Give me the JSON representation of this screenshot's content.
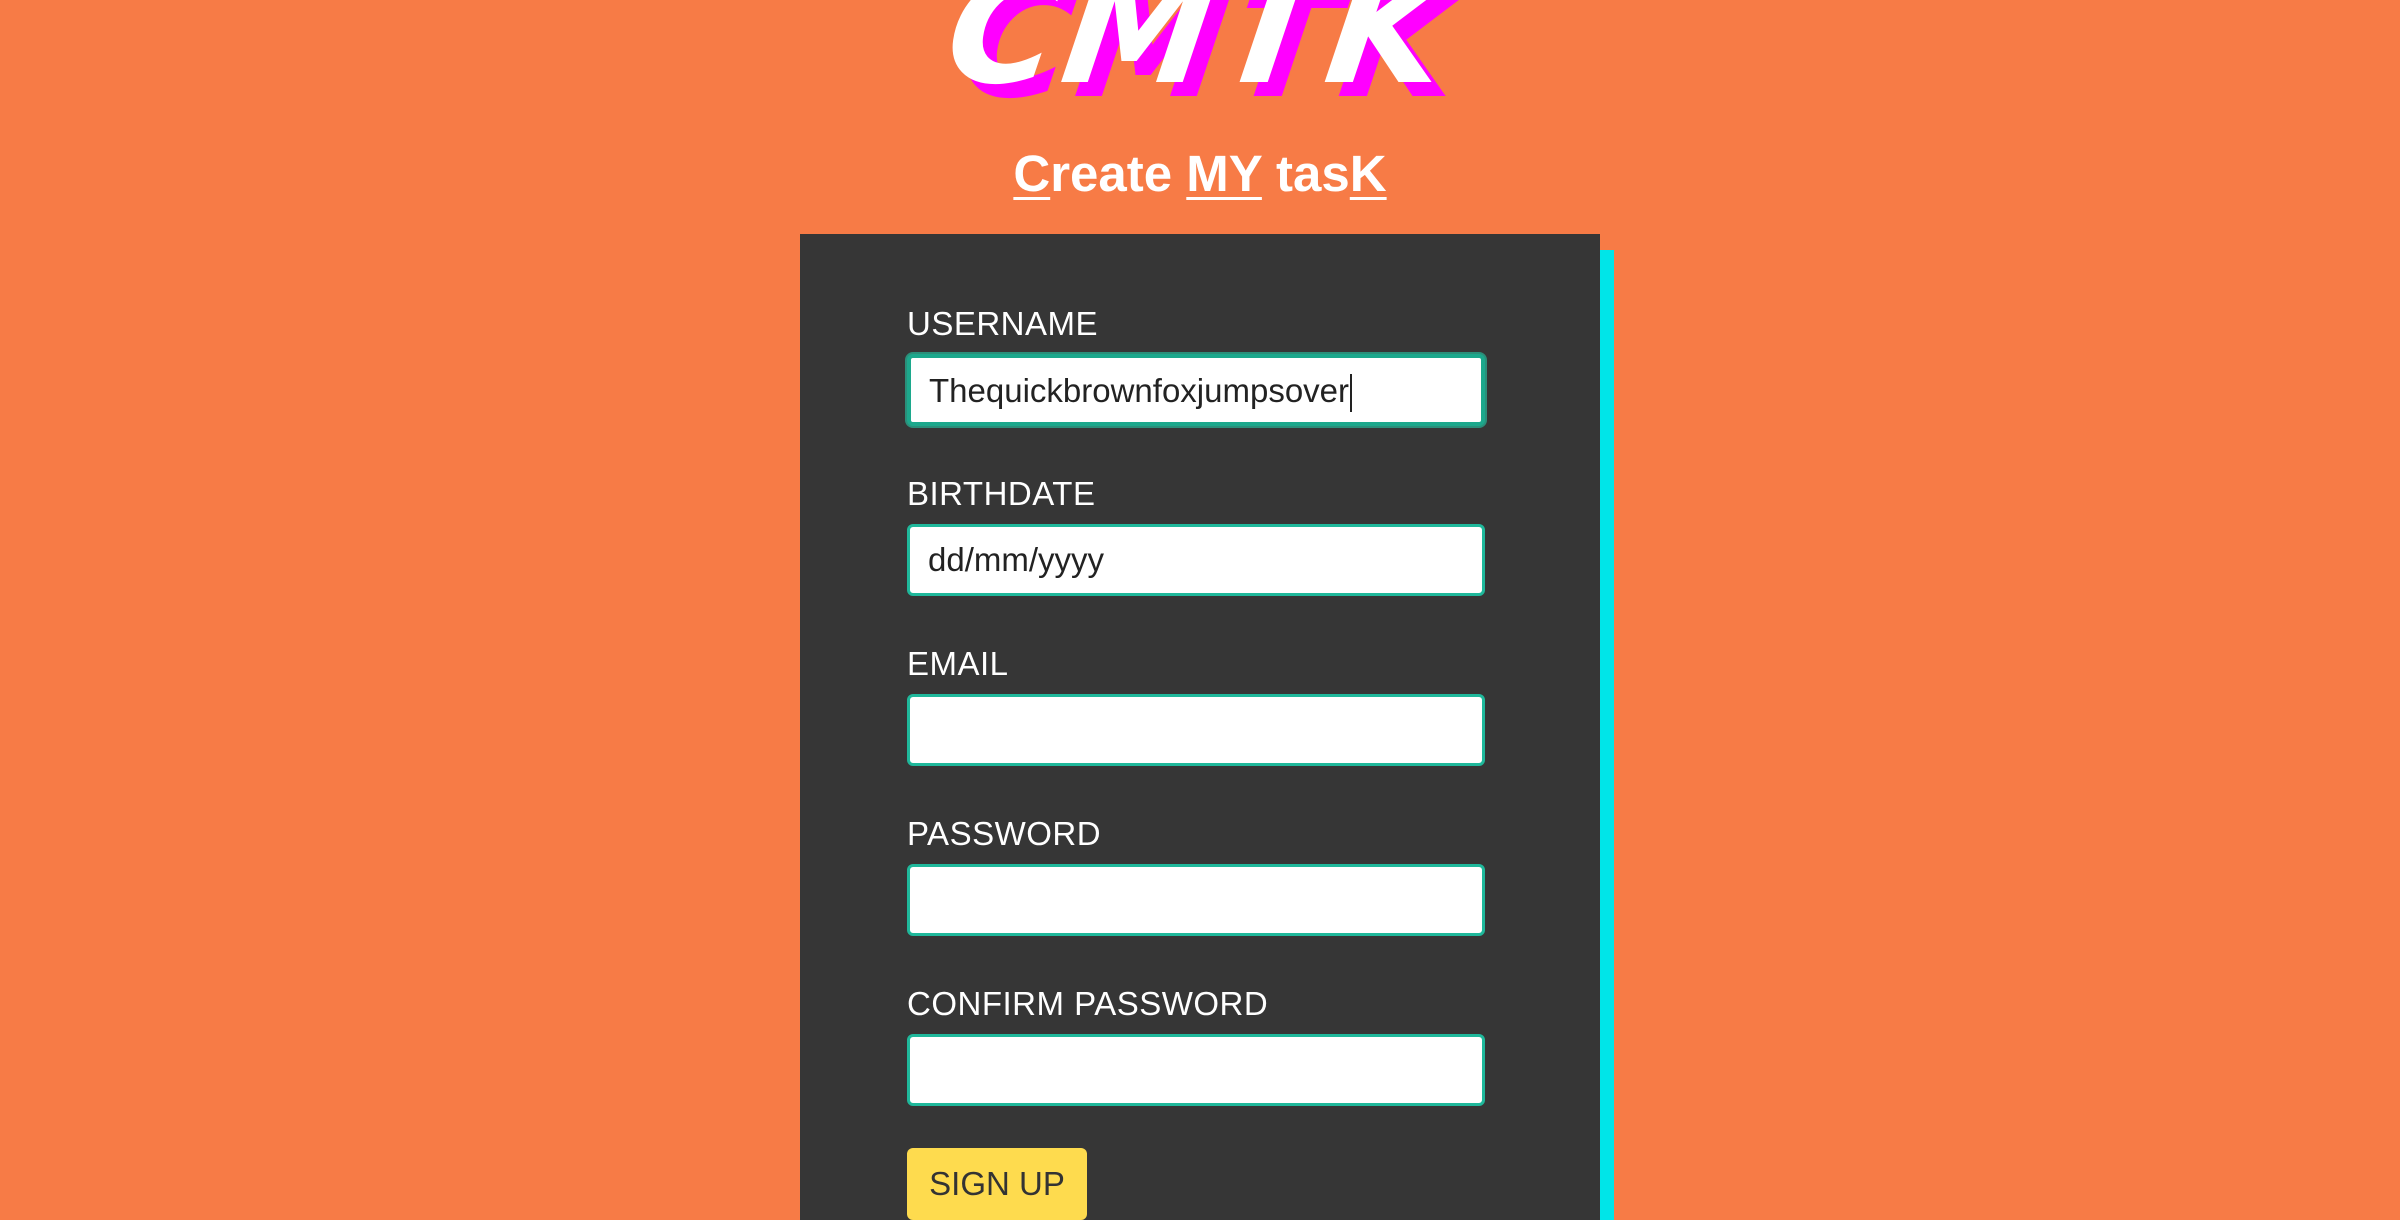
{
  "logo": {
    "text": "CMTK",
    "colors": {
      "fill": "#ffffff",
      "shadow": "#ff00ff"
    }
  },
  "subtitle": {
    "parts": [
      "C",
      "reate ",
      "MY",
      " tas",
      "K"
    ]
  },
  "form": {
    "fields": [
      {
        "label": "USERNAME",
        "value": "Thequickbrownfoxjumpsover",
        "placeholder": ""
      },
      {
        "label": "BIRTHDATE",
        "value": "",
        "placeholder": "dd/mm/yyyy"
      },
      {
        "label": "EMAIL",
        "value": "",
        "placeholder": ""
      },
      {
        "label": "PASSWORD",
        "value": "",
        "placeholder": ""
      },
      {
        "label": "CONFIRM PASSWORD",
        "value": "",
        "placeholder": ""
      }
    ],
    "submit_label": "SIGN UP"
  },
  "colors": {
    "background": "#f77b46",
    "card": "#363636",
    "accent_bar": "#00e5e8",
    "input_border": "#1fb89b",
    "button": "#fedb4e"
  }
}
